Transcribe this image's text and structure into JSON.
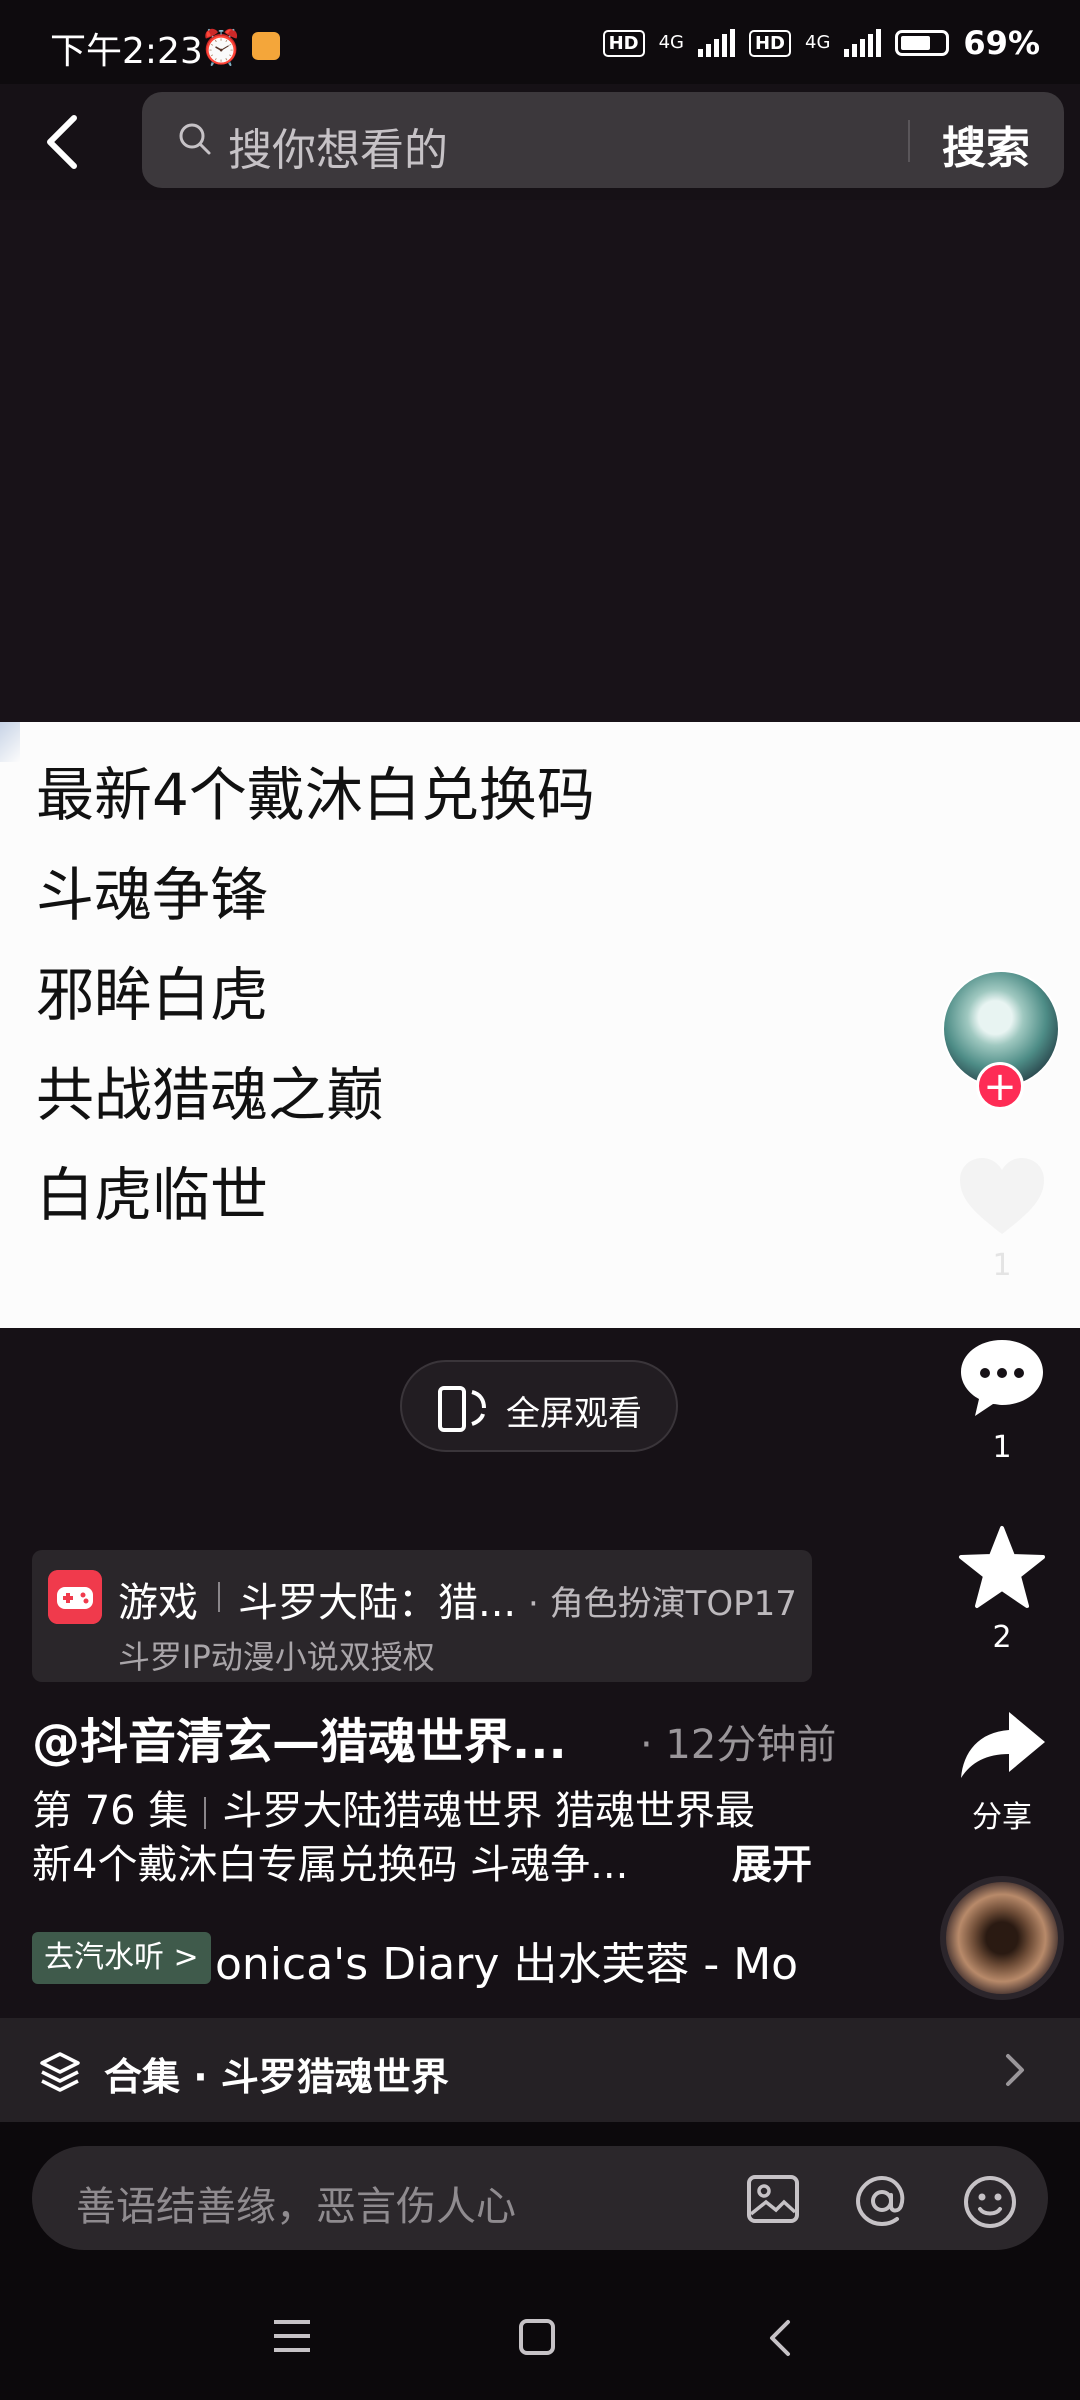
{
  "status_bar": {
    "time": "下午2:23",
    "network_1": "4G",
    "network_2": "4G",
    "hd_1": "HD",
    "hd_2": "HD",
    "battery": "69%"
  },
  "search": {
    "placeholder": "搜你想看的",
    "button_label": "搜索"
  },
  "video_frame": {
    "lines": [
      "最新4个戴沐白兑换码",
      "斗魂争锋",
      "邪眸白虎",
      "共战猎魂之巅",
      "白虎临世"
    ]
  },
  "fullscreen": {
    "label": "全屏观看"
  },
  "right_rail": {
    "like_count": "1",
    "comment_count": "1",
    "favorite_count": "2",
    "share_label": "分享"
  },
  "anchor": {
    "type": "游戏",
    "title": "斗罗大陆：猎...",
    "rank": "· 角色扮演TOP17",
    "subtitle": "斗罗IP动漫小说双授权"
  },
  "post": {
    "author": "@抖音清玄—猎魂世界...",
    "time": "· 12分钟前",
    "episode": "第 76 集",
    "desc_line1_rest": "斗罗大陆猎魂世界 猎魂世界最",
    "desc_line2": "新4个戴沐白专属兑换码 斗魂争...",
    "expand_label": "展开"
  },
  "music": {
    "tag": "去汽水听 >",
    "title": "onica's Diary    出水芙蓉 - Mo"
  },
  "collection": {
    "label": "合集 · 斗罗猎魂世界"
  },
  "comment": {
    "placeholder": "善语结善缘，恶言伤人心"
  },
  "colors": {
    "accent_red": "#fe2c55",
    "background": "#161116",
    "music_tag": "#3f5a4b"
  }
}
